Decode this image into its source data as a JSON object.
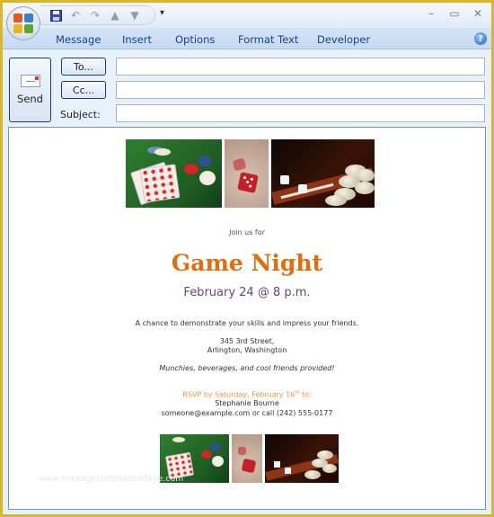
{
  "window": {
    "quick_access": [
      "save-icon",
      "undo-icon",
      "redo-icon",
      "previous-item-icon",
      "next-item-icon"
    ],
    "customize_glyph": "▾",
    "controls": {
      "minimize": "–",
      "maximize": "▭",
      "close": "✕"
    }
  },
  "ribbon": {
    "tabs": [
      "Message",
      "Insert",
      "Options",
      "Format Text",
      "Developer"
    ],
    "help_glyph": "?"
  },
  "header": {
    "send_label": "Send",
    "to_label": "To...",
    "cc_label": "Cc...",
    "subject_label": "Subject:",
    "to_value": "",
    "cc_value": "",
    "subject_value": ""
  },
  "invitation": {
    "top_images": [
      "poker-cards-chips-photo",
      "red-dice-photo",
      "backgammon-photo"
    ],
    "join_us": "Join us for",
    "title": "Game Night",
    "date": "February 24 @ 8 p.m.",
    "description": "A chance to demonstrate your skills and impress your friends.",
    "address_line1": "345 3rd Street,",
    "address_line2": "Arlington, Washington",
    "munchies": "Munchies, beverages, and cool friends provided!",
    "rsvp_prefix": "RSVP by Saturday, February 16",
    "rsvp_sup": "th",
    "rsvp_suffix": " to:",
    "rsvp_name": "Stephanie Bourne",
    "rsvp_contact": "someone@example.com or call (242) 555-0177",
    "bottom_images": [
      "poker-cards-chips-photo",
      "red-dice-photo",
      "backgammon-photo"
    ],
    "watermark": "www.heritagechristiancollege.com"
  },
  "colors": {
    "title": "#e46c0a",
    "date": "#5f497a",
    "rsvp": "#f09640",
    "ribbon_text": "#15428b",
    "window_frame": "#d9b62a"
  }
}
